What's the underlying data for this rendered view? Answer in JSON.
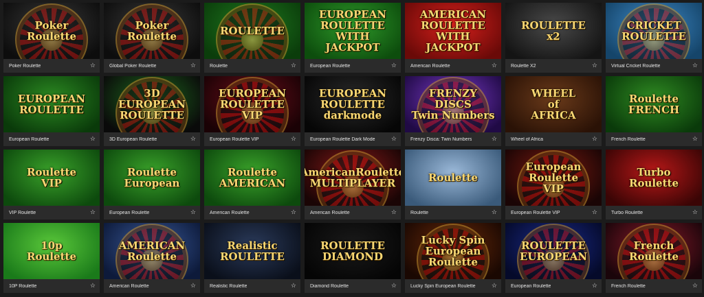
{
  "games": [
    {
      "name": "Poker Roulette",
      "thumb_text": "Poker\nRoulette",
      "bg": "#3a3a3a",
      "bg2": "#0d0d0d",
      "wheel": true
    },
    {
      "name": "Global Poker Roulette",
      "thumb_text": "Poker\nRoulette",
      "bg": "#3a3a3a",
      "bg2": "#0d0d0d",
      "wheel": true
    },
    {
      "name": "Roulette",
      "thumb_text": "ROULETTE",
      "bg": "#1f7a1f",
      "bg2": "#0b3d0b",
      "wheel": true
    },
    {
      "name": "European Roulette",
      "thumb_text": "EUROPEAN\nROULETTE\nWITH JACKPOT",
      "bg": "#2f9a2a",
      "bg2": "#0d4d0d",
      "wheel": false
    },
    {
      "name": "American Roulette",
      "thumb_text": "AMERICAN\nROULETTE\nWITH JACKPOT",
      "bg": "#d8201c",
      "bg2": "#6a0a08",
      "wheel": false
    },
    {
      "name": "Roulette X2",
      "thumb_text": "ROULETTE\nx2",
      "bg": "#4a4a4a",
      "bg2": "#141414",
      "wheel": false
    },
    {
      "name": "Virtual Cricket Roulette",
      "thumb_text": "CRICKET\nROULETTE",
      "bg": "#3f8ac8",
      "bg2": "#15456a",
      "wheel": true
    },
    {
      "name": "European Roulette",
      "thumb_text": "EUROPEAN\nROULETTE",
      "bg": "#2c8a22",
      "bg2": "#0a3a0a",
      "wheel": false
    },
    {
      "name": "3D European Roulette",
      "thumb_text": "3D\nEUROPEAN\nROULETTE",
      "bg": "#1e6a1e",
      "bg2": "#0a0a0a",
      "wheel": true
    },
    {
      "name": "European Roulette VIP",
      "thumb_text": "EUROPEAN ROULETTE\nVIP",
      "bg": "#6a0f1a",
      "bg2": "#1a0205",
      "wheel": true
    },
    {
      "name": "European Roulette Dark Mode",
      "thumb_text": "EUROPEAN\nROULETTE\ndarkmode",
      "bg": "#2a2a2a",
      "bg2": "#060606",
      "wheel": false
    },
    {
      "name": "Frenzy Disca: Twin Numbers",
      "thumb_text": "FRENZY\nDISCS\nTwin Numbers",
      "bg": "#7a3ac8",
      "bg2": "#200a45",
      "wheel": true
    },
    {
      "name": "Wheel of Africa",
      "thumb_text": "WHEEL\nof\nAFRICA",
      "bg": "#6a3a1a",
      "bg2": "#2a1206",
      "wheel": false
    },
    {
      "name": "French Roulette",
      "thumb_text": "Roulette\nFRENCH",
      "bg": "#2f8a22",
      "bg2": "#0a3a0a",
      "wheel": false
    },
    {
      "name": "VIP Roulette",
      "thumb_text": "Roulette\nVIP",
      "bg": "#3aa22a",
      "bg2": "#0d4a0d",
      "wheel": false
    },
    {
      "name": "European Roulette",
      "thumb_text": "Roulette\nEuropean",
      "bg": "#3aa22a",
      "bg2": "#0d4a0d",
      "wheel": false
    },
    {
      "name": "American Roulette",
      "thumb_text": "Roulette\nAMERICAN",
      "bg": "#3aa22a",
      "bg2": "#0d4a0d",
      "wheel": false
    },
    {
      "name": "American Roulette",
      "thumb_text": "AmericanRoulette\nMULTIPLAYER",
      "bg": "#8a1a1a",
      "bg2": "#1a0505",
      "wheel": true
    },
    {
      "name": "Roulette",
      "thumb_text": "Roulette",
      "bg": "#9ab8d8",
      "bg2": "#3a5a7a",
      "wheel": false
    },
    {
      "name": "European Roulette VIP",
      "thumb_text": "European Roulette\nVIP",
      "bg": "#7a1a10",
      "bg2": "#1a0505",
      "wheel": true
    },
    {
      "name": "Turbo Roulette",
      "thumb_text": "Turbo\nRoulette",
      "bg": "#b81818",
      "bg2": "#3a0505",
      "wheel": false
    },
    {
      "name": "10P Roulette",
      "thumb_text": "10p\nRoulette",
      "bg": "#5ac83a",
      "bg2": "#1a7a1a",
      "wheel": false
    },
    {
      "name": "American Roulette",
      "thumb_text": "AMERICAN\nRoulette",
      "bg": "#3a5a9a",
      "bg2": "#0d1a3a",
      "wheel": true
    },
    {
      "name": "Realistic Roulette",
      "thumb_text": "Realistic\nROULETTE",
      "bg": "#2a3a5a",
      "bg2": "#0a0f1a",
      "wheel": false
    },
    {
      "name": "Diamond Roulette",
      "thumb_text": "ROULETTE DIAMOND",
      "bg": "#1a1a1a",
      "bg2": "#050505",
      "wheel": false
    },
    {
      "name": "Lucky Spin European Roulette",
      "thumb_text": "Lucky Spin European\nRoulette",
      "bg": "#6a2a0a",
      "bg2": "#1a0802",
      "wheel": true
    },
    {
      "name": "European Roulette",
      "thumb_text": "ROULETTE\nEUROPEAN",
      "bg": "#1a2a8a",
      "bg2": "#050a2a",
      "wheel": true
    },
    {
      "name": "French Roulette",
      "thumb_text": "French\nRoulette",
      "bg": "#8a1a2a",
      "bg2": "#1a050a",
      "wheel": true
    }
  ],
  "colors": {
    "page_bg": "#1b1b1b",
    "caption_bg": "#2b2b2b",
    "caption_text": "#e6e6e6"
  },
  "icons": {
    "favorite": "star-outline-icon"
  }
}
